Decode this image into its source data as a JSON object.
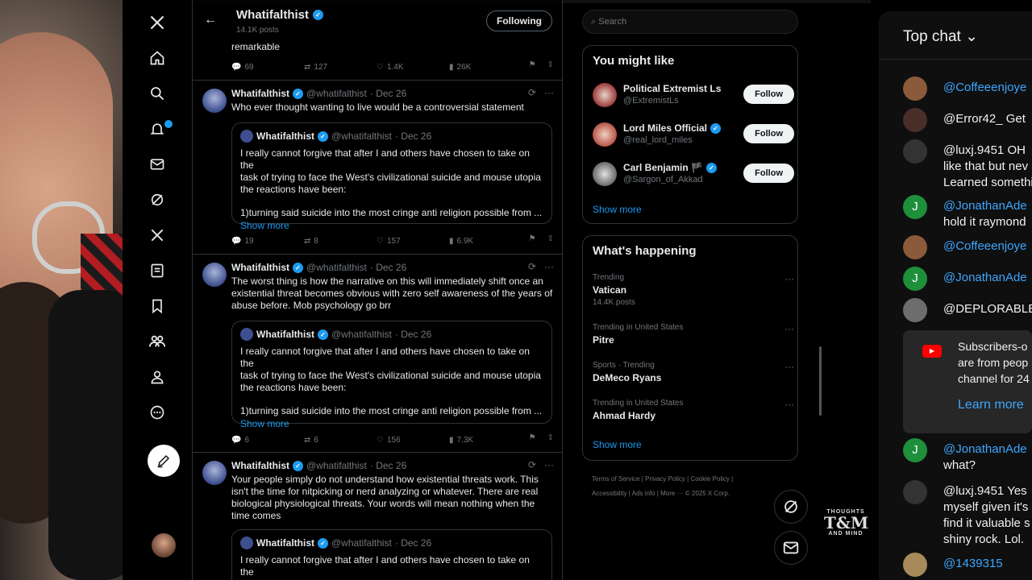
{
  "header": {
    "title": "Whatifalthist",
    "posts_count": "14.1K posts",
    "following_label": "Following"
  },
  "prev_tweet": {
    "text_partial": "remarkable",
    "replies": "69",
    "reposts": "127",
    "likes": "1.4K",
    "views": "26K"
  },
  "tweets": [
    {
      "name": "Whatifalthist",
      "handle": "@whatifalthist",
      "date": "· Dec 26",
      "text": "Who ever thought wanting to live would be a controversial statement",
      "quote": {
        "name": "Whatifalthist",
        "handle": "@whatifalthist",
        "date": "· Dec 26",
        "line1": "I really cannot forgive that after I and others have chosen to take on the",
        "line2": "task of trying to face the West's civilizational suicide and mouse utopia",
        "line3": "the reactions have been:",
        "line4": "1)turning said suicide into the most cringe anti religion possible from ...",
        "show_more": "Show more"
      },
      "replies": "19",
      "reposts": "8",
      "likes": "157",
      "views": "6.9K"
    },
    {
      "name": "Whatifalthist",
      "handle": "@whatifalthist",
      "date": "· Dec 26",
      "line1": "The worst thing is how the narrative on this will immediately shift once an",
      "line2": "existential threat becomes obvious with zero self awareness of the years of",
      "line3": "abuse before. Mob psychology go brr",
      "quote": {
        "name": "Whatifalthist",
        "handle": "@whatifalthist",
        "date": "· Dec 26",
        "line1": "I really cannot forgive that after I and others have chosen to take on the",
        "line2": "task of trying to face the West's civilizational suicide and mouse utopia",
        "line3": "the reactions have been:",
        "line4": "1)turning said suicide into the most cringe anti religion possible from ...",
        "show_more": "Show more"
      },
      "replies": "6",
      "reposts": "6",
      "likes": "156",
      "views": "7.3K"
    },
    {
      "name": "Whatifalthist",
      "handle": "@whatifalthist",
      "date": "· Dec 26",
      "line1": "Your people simply do not understand how existential threats work. This",
      "line2": "isn't the time for nitpicking or nerd analyzing or whatever. There are real",
      "line3": "biological physiological threats. Your words will mean nothing when the",
      "line4": "time comes",
      "quote": {
        "name": "Whatifalthist",
        "handle": "@whatifalthist",
        "date": "· Dec 26",
        "line1": "I really cannot forgive that after I and others have chosen to take on the"
      }
    }
  ],
  "sidebar": {
    "search_placeholder": "Search",
    "you_might_like": {
      "title": "You might like",
      "users": [
        {
          "name": "Political Extremist Ls",
          "handle": "@ExtremistLs",
          "button": "Follow"
        },
        {
          "name": "Lord Miles Official",
          "handle": "@real_lord_miles",
          "button": "Follow"
        },
        {
          "name": "Carl Benjamin 🏴",
          "handle": "@Sargon_of_Akkad",
          "button": "Follow"
        }
      ],
      "show_more": "Show more"
    },
    "happening": {
      "title": "What's happening",
      "trends": [
        {
          "meta": "Trending",
          "title": "Vatican",
          "sub": "14.4K posts"
        },
        {
          "meta": "Trending in United States",
          "title": "Pitre",
          "sub": ""
        },
        {
          "meta": "Sports · Trending",
          "title": "DeMeco Ryans",
          "sub": ""
        },
        {
          "meta": "Trending in United States",
          "title": "Ahmad Hardy",
          "sub": ""
        }
      ],
      "show_more": "Show more"
    },
    "footer": {
      "terms": "Terms of Service",
      "privacy": "Privacy Policy",
      "cookie": "Cookie Policy",
      "accessibility": "Accessibility",
      "ads": "Ads info",
      "more": "More ···",
      "copyright": "© 2025 X Corp."
    }
  },
  "brand": {
    "top": "THOUGHTS",
    "mid": "T&M",
    "bottom": "AND MIND"
  },
  "chat": {
    "title": "Top chat",
    "messages": [
      {
        "user": "@Coffeeenjoye",
        "text": ""
      },
      {
        "user": "@Error42_",
        "text": "Get"
      },
      {
        "user": "@luxj.9451",
        "text": "OH",
        "l2": "like that but nev",
        "l3": "Learned somethi"
      },
      {
        "user": "@JonathanAde",
        "text": "",
        "l2": "hold it raymond"
      },
      {
        "user": "@Coffeeenjoye",
        "text": ""
      },
      {
        "user": "@JonathanAde",
        "text": ""
      },
      {
        "user": "@DEPLORABLE",
        "text": ""
      },
      {
        "user": "@JonathanAde",
        "text": "",
        "l2": "what?"
      },
      {
        "user": "@luxj.9451",
        "text": "Yes",
        "l2": "myself given it's",
        "l3": "find it valuable s",
        "l4": "shiny rock. Lol."
      },
      {
        "user": "@1439315",
        "text": ""
      }
    ],
    "promo": {
      "l1": "Subscribers-o",
      "l2": "are from peop",
      "l3": "channel for 24",
      "learn_more": "Learn more"
    }
  }
}
